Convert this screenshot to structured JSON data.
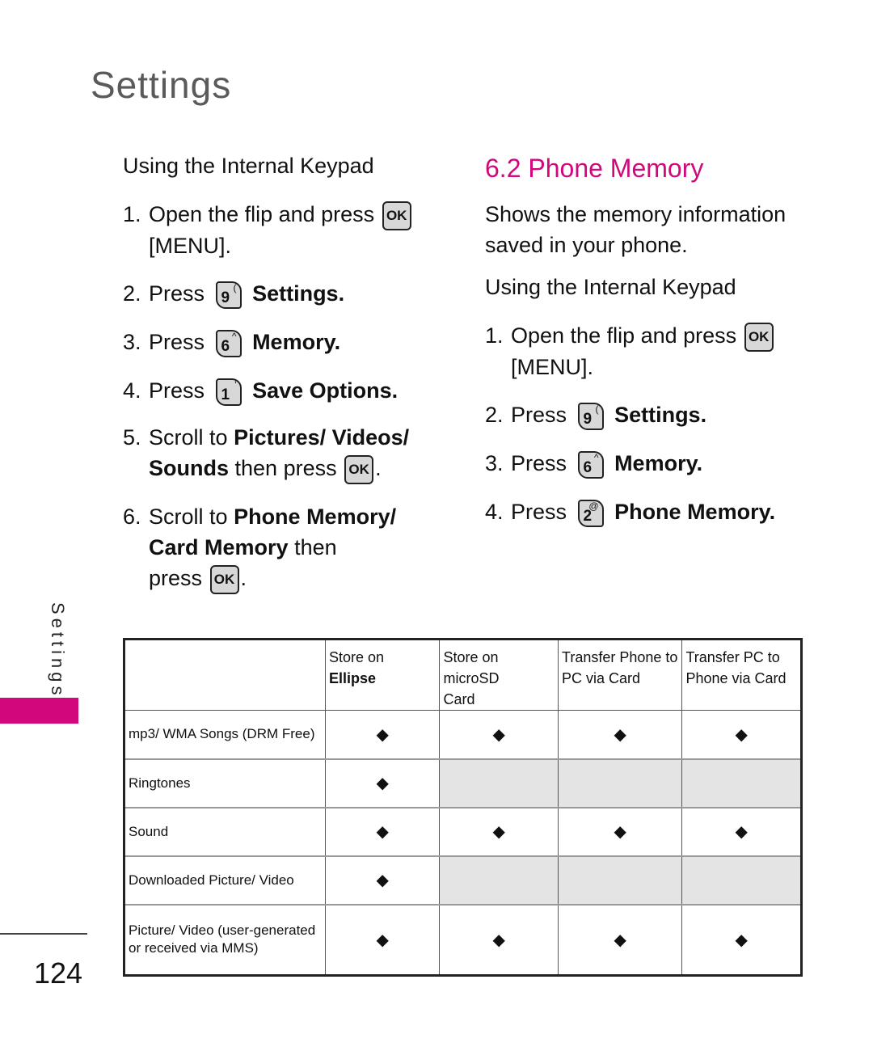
{
  "header": {
    "title": "Settings"
  },
  "left_column": {
    "subheading": "Using the Internal Keypad",
    "steps": [
      {
        "num": "1.",
        "text": "Open the flip and press",
        "key": "OK",
        "line2": "[MENU]."
      },
      {
        "num": "2.",
        "pre": "Press",
        "key_digit": "9",
        "key_sym": "(",
        "label": "Settings."
      },
      {
        "num": "3.",
        "pre": "Press",
        "key_digit": "6",
        "key_sym": "^",
        "label": "Memory."
      },
      {
        "num": "4.",
        "pre": "Press",
        "key_digit": "1",
        "key_sym": "'",
        "label": "Save Options."
      },
      {
        "num": "5.",
        "pre": "Scroll to",
        "bold1": "Pictures/ Videos/",
        "bold2": "Sounds",
        "mid": "then press",
        "key": "OK",
        "end": "."
      },
      {
        "num": "6.",
        "pre": "Scroll to",
        "bold1": "Phone Memory/",
        "bold2": "Card Memory",
        "mid": "then",
        "line3": "press",
        "key": "OK",
        "end": "."
      }
    ]
  },
  "right_column": {
    "section_title": "6.2 Phone Memory",
    "description_line1": "Shows the memory information",
    "description_line2": "saved in your phone.",
    "subheading": "Using the Internal Keypad",
    "steps": [
      {
        "num": "1.",
        "text": "Open the flip and press",
        "key": "OK",
        "line2": "[MENU]."
      },
      {
        "num": "2.",
        "pre": "Press",
        "key_digit": "9",
        "key_sym": "(",
        "label": "Settings."
      },
      {
        "num": "3.",
        "pre": "Press",
        "key_digit": "6",
        "key_sym": "^",
        "label": "Memory."
      },
      {
        "num": "4.",
        "pre": "Press",
        "key_digit": "2",
        "key_sym": "@",
        "label": "Phone Memory."
      }
    ]
  },
  "side": {
    "label": "Settings",
    "accent": "#d1077b"
  },
  "page_number": "124",
  "table": {
    "headers": [
      {
        "line1": "",
        "line2": ""
      },
      {
        "line1": "Store on",
        "line2": "Ellipse",
        "bold2": true
      },
      {
        "line1": "Store on microSD",
        "line2": "Card"
      },
      {
        "line1": "Transfer Phone to",
        "line2": "PC via Card"
      },
      {
        "line1": "Transfer PC to",
        "line2": "Phone via Card"
      }
    ],
    "mark_symbol": "◆",
    "rows": [
      {
        "label": "mp3/ WMA Songs (DRM Free)",
        "cells": [
          true,
          true,
          true,
          true
        ]
      },
      {
        "label": "Ringtones",
        "cells": [
          true,
          false,
          false,
          false
        ]
      },
      {
        "label": "Sound",
        "cells": [
          true,
          true,
          true,
          true
        ]
      },
      {
        "label": "Downloaded Picture/ Video",
        "cells": [
          true,
          false,
          false,
          false
        ]
      },
      {
        "label": "Picture/ Video (user-generated or received via MMS)",
        "cells": [
          true,
          true,
          true,
          true
        ]
      }
    ]
  }
}
